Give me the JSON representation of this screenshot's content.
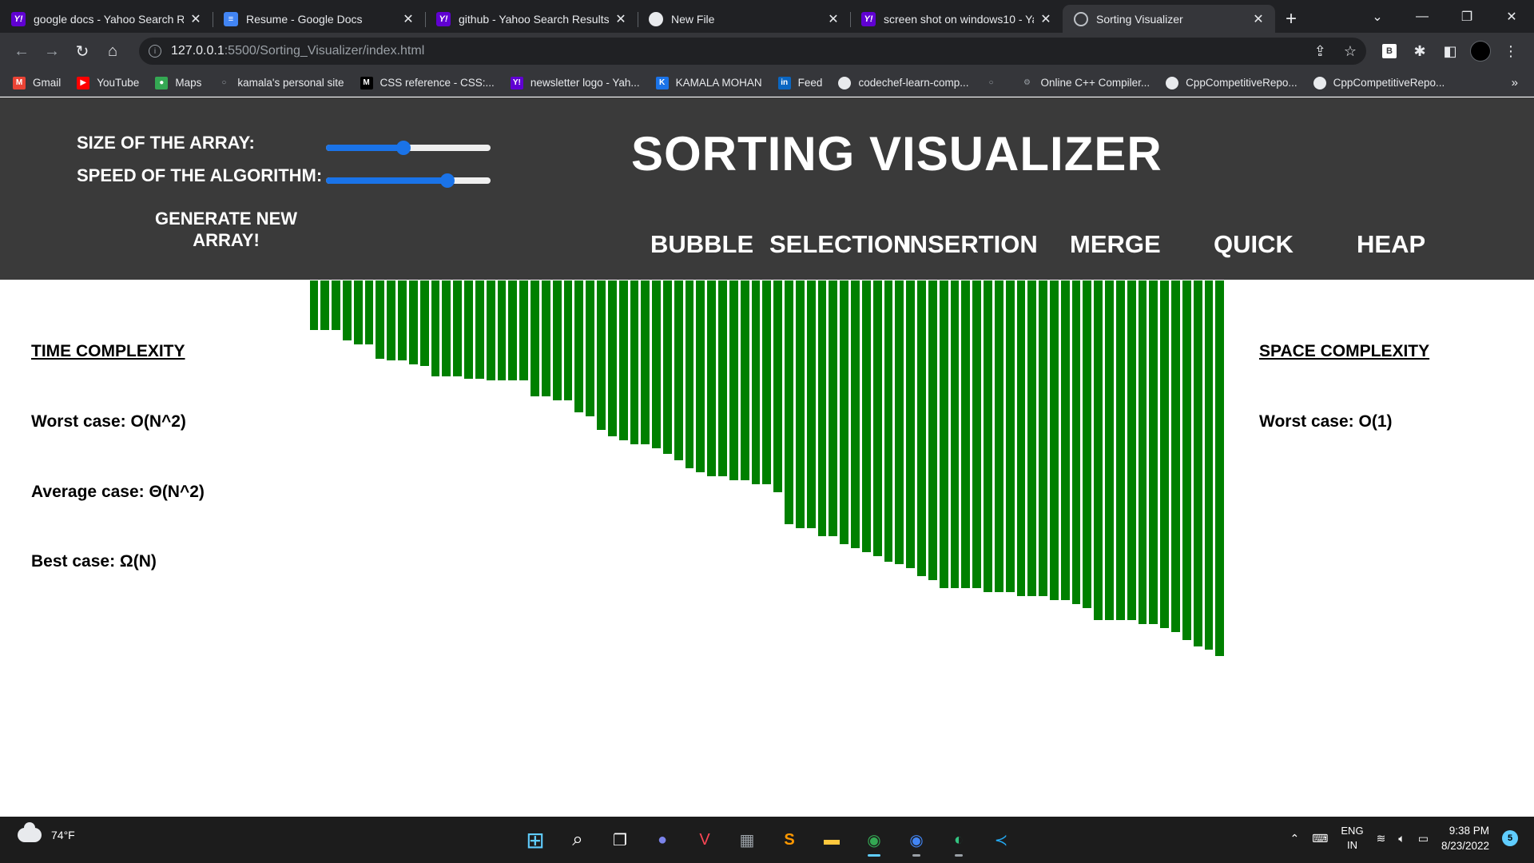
{
  "browser": {
    "tabs": [
      {
        "title": "google docs - Yahoo Search Re",
        "icon": "yahoo-icon",
        "glyph": "Y!",
        "active": false
      },
      {
        "title": "Resume - Google Docs",
        "icon": "docs-icon",
        "glyph": "≡",
        "active": false
      },
      {
        "title": "github - Yahoo Search Results",
        "icon": "yahoo-icon",
        "glyph": "Y!",
        "active": false
      },
      {
        "title": "New File",
        "icon": "github-icon",
        "glyph": "",
        "active": false
      },
      {
        "title": "screen shot on windows10 - Ya",
        "icon": "yahoo-icon",
        "glyph": "Y!",
        "active": false
      },
      {
        "title": "Sorting Visualizer",
        "icon": "globe-icon",
        "glyph": "",
        "active": true
      }
    ],
    "new_tab": "+",
    "url_host": "127.0.0.1",
    "url_path": ":5500/Sorting_Visualizer/index.html",
    "bookmarks": [
      {
        "label": "Gmail",
        "icon": "gmail-icon",
        "color": "#ea4335",
        "glyph": "M"
      },
      {
        "label": "YouTube",
        "icon": "youtube-icon",
        "color": "#ff0000",
        "glyph": "▶"
      },
      {
        "label": "Maps",
        "icon": "maps-icon",
        "color": "#34a853",
        "glyph": "●"
      },
      {
        "label": "kamala's personal site",
        "icon": "globe-icon",
        "color": "#5f6368",
        "glyph": "○"
      },
      {
        "label": "CSS reference - CSS:...",
        "icon": "mdn-icon",
        "color": "#000000",
        "glyph": "M"
      },
      {
        "label": "newsletter logo - Yah...",
        "icon": "yahoo-icon",
        "color": "#6001d2",
        "glyph": "Y!"
      },
      {
        "label": "KAMALA MOHAN",
        "icon": "k-icon",
        "color": "#1a73e8",
        "glyph": "K"
      },
      {
        "label": "Feed",
        "icon": "linkedin-icon",
        "color": "#0a66c2",
        "glyph": "in"
      },
      {
        "label": "codechef-learn-comp...",
        "icon": "github-icon",
        "color": "#e8eaed",
        "glyph": ""
      },
      {
        "label": "",
        "icon": "globe-icon",
        "color": "#5f6368",
        "glyph": "○"
      },
      {
        "label": "Online C++ Compiler...",
        "icon": "compiler-icon",
        "color": "#5f6368",
        "glyph": "⚙"
      },
      {
        "label": "CppCompetitiveRepo...",
        "icon": "github-icon",
        "color": "#e8eaed",
        "glyph": ""
      },
      {
        "label": "CppCompetitiveRepo...",
        "icon": "github-icon",
        "color": "#e8eaed",
        "glyph": ""
      }
    ],
    "bookmarks_more": "»"
  },
  "app": {
    "title": "SORTING VISUALIZER",
    "size_label": "SIZE OF THE ARRAY:",
    "speed_label": "SPEED OF THE ALGORITHM:",
    "size_level": 0.47,
    "speed_level": 0.74,
    "generate_label": "GENERATE NEW ARRAY!",
    "algorithms": [
      "BUBBLE",
      "SELECTION",
      "INSERTION",
      "MERGE",
      "QUICK",
      "HEAP"
    ],
    "bar_color": "#008000",
    "bars": [
      62,
      62,
      62,
      75,
      80,
      80,
      98,
      100,
      100,
      105,
      107,
      120,
      120,
      120,
      123,
      123,
      125,
      125,
      125,
      125,
      145,
      145,
      150,
      150,
      165,
      170,
      187,
      195,
      200,
      205,
      205,
      210,
      217,
      225,
      235,
      240,
      245,
      245,
      250,
      250,
      255,
      255,
      265,
      305,
      310,
      310,
      320,
      320,
      330,
      335,
      340,
      345,
      352,
      355,
      360,
      370,
      375,
      385,
      385,
      385,
      385,
      390,
      390,
      390,
      395,
      395,
      395,
      400,
      400,
      405,
      410,
      425,
      425,
      425,
      425,
      430,
      430,
      435,
      440,
      450,
      458,
      462,
      470
    ]
  },
  "time_complexity": {
    "heading": "TIME COMPLEXITY",
    "worst": "Worst case: O(N^2)",
    "average": "Average case: Θ(N^2)",
    "best": "Best case: Ω(N)"
  },
  "space_complexity": {
    "heading": "SPACE COMPLEXITY",
    "worst": "Worst case: O(1)"
  },
  "taskbar": {
    "weather": "74°F",
    "lang_top": "ENG",
    "lang_bottom": "IN",
    "time": "9:38 PM",
    "date": "8/23/2022",
    "notifications": "5"
  }
}
